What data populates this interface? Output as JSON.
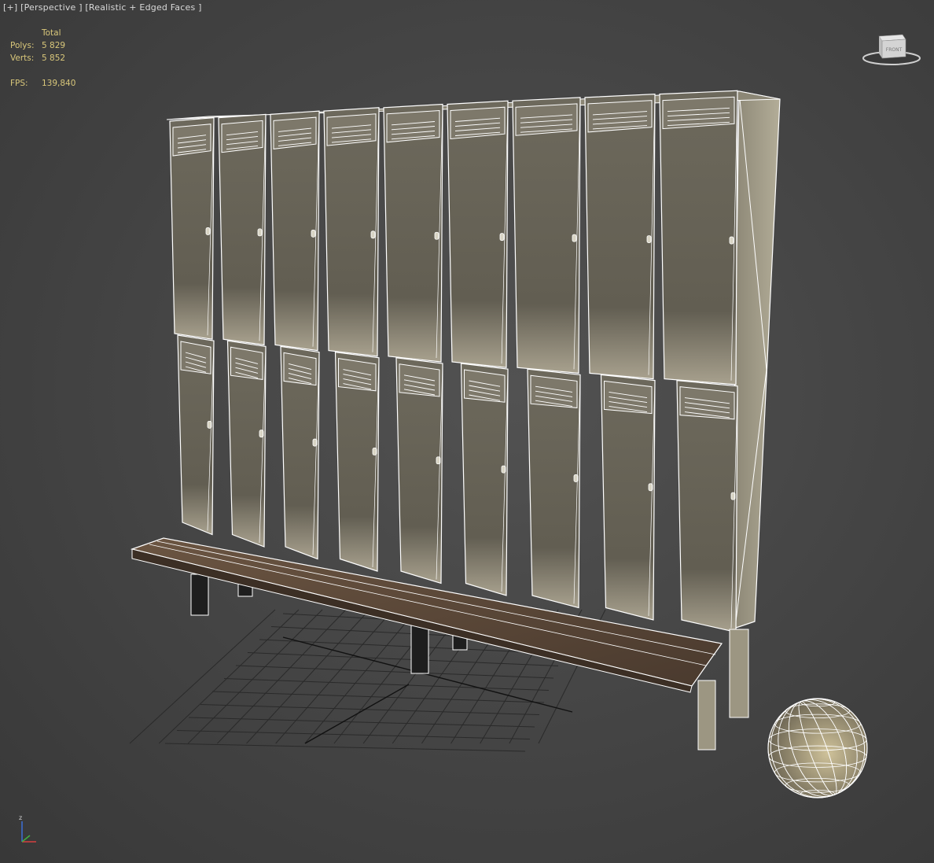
{
  "viewport": {
    "label_plus": "[+]",
    "label_view": "[Perspective ]",
    "label_shading": "[Realistic + Edged Faces ]"
  },
  "stats": {
    "header": "Total",
    "polys_label": "Polys:",
    "polys_value": "5 829",
    "verts_label": "Verts:",
    "verts_value": "5 852",
    "fps_label": "FPS:",
    "fps_value": "139,840"
  },
  "viewcube": {
    "face_label": "FRONT",
    "icon": "viewcube-icon"
  },
  "axis": {
    "z_label": "z"
  },
  "colors": {
    "background": "#464646",
    "locker_face": "#6e6a5e",
    "wire": "#ffffff",
    "bench_wood": "#5e4a3a",
    "stats_text": "#d9c77a"
  }
}
